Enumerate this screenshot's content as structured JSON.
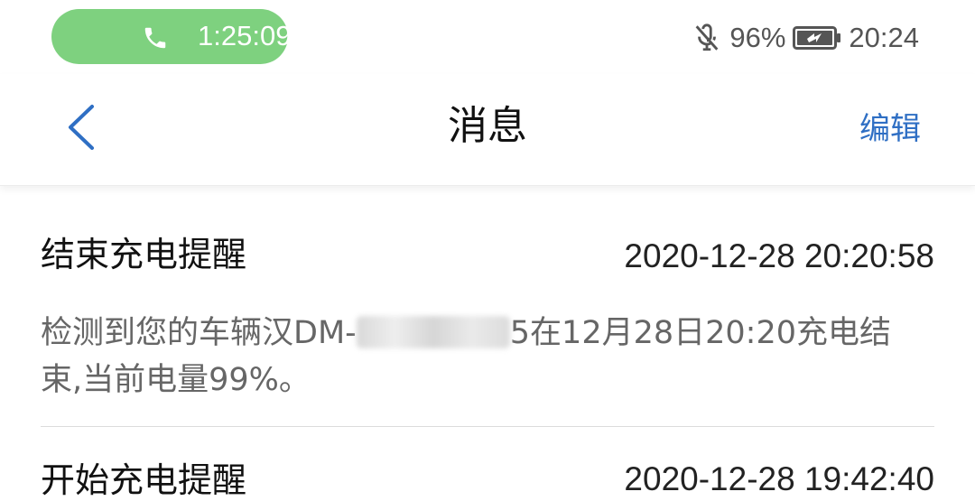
{
  "status_bar": {
    "call_timer": "1:25:09",
    "battery_percent": "96%",
    "clock": "20:24",
    "call_pill_color": "#7ed17f"
  },
  "nav": {
    "title": "消息",
    "edit_label": "编辑",
    "accent_color": "#2f6fc4"
  },
  "messages": [
    {
      "title": "结束充电提醒",
      "time": "2020-12-28 20:20:58",
      "body_prefix": "检测到您的车辆汉DM-",
      "body_suffix": "5在12月28日20:20充电结束,当前电量99%。"
    },
    {
      "title": "开始充电提醒",
      "time": "2020-12-28 19:42:40"
    }
  ],
  "icons": [
    "phone-icon",
    "mic-off-icon",
    "battery-charging-icon",
    "back-chevron-icon"
  ]
}
